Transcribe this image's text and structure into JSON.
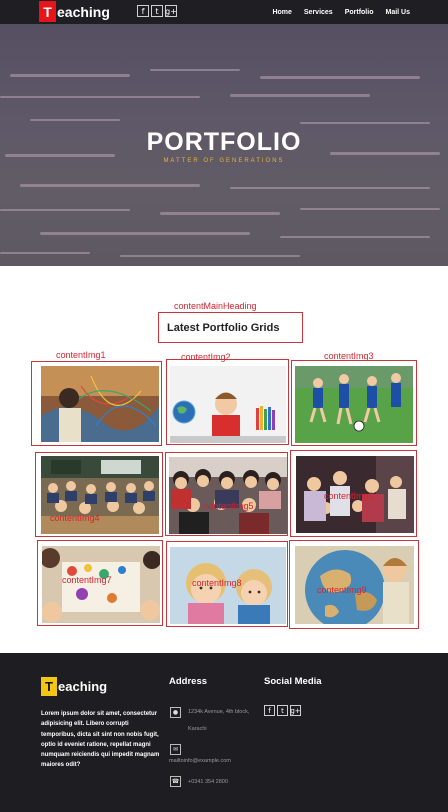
{
  "nav": {
    "logo_initial": "T",
    "logo_rest": "eaching",
    "social": [
      {
        "icon": "facebook-icon",
        "glyph": "f"
      },
      {
        "icon": "twitter-icon",
        "glyph": "t"
      },
      {
        "icon": "google-plus-icon",
        "glyph": "g+"
      }
    ],
    "menu": [
      "Home",
      "Services",
      "Portfolio",
      "Mail Us"
    ]
  },
  "hero": {
    "title": "PORTFOLIO",
    "subtitle": "MATTER OF GENERATIONS"
  },
  "content": {
    "main_heading_annotation": "contentMainHeading",
    "main_heading": "Latest Portfolio Grids",
    "images": [
      {
        "label": "contentImg1",
        "alt": "children crafting with colorful yarn"
      },
      {
        "label": "contentImg2",
        "alt": "boy at desk with globe and pencils"
      },
      {
        "label": "contentImg3",
        "alt": "kids playing soccer on field"
      },
      {
        "label": "contentImg4",
        "alt": "classroom full of students"
      },
      {
        "label": "contentImg5",
        "alt": "group of smiling kids"
      },
      {
        "label": "contentImg6",
        "alt": "mothers and children in classroom"
      },
      {
        "label": "contentImg7",
        "alt": "kids painting at table"
      },
      {
        "label": "contentImg8",
        "alt": "two smiling blond children"
      },
      {
        "label": "contentImg9",
        "alt": "child pointing at globe"
      }
    ]
  },
  "footer": {
    "logo_initial": "T",
    "logo_rest": "eaching",
    "description": "Lorem ipsum dolor sit amet, consectetur adipisicing elit. Libero corrupti temporibus, dicta sit sint non nobis fugit, optio id eveniet ratione, repellat magni numquam reiciendis qui impedit magnam maiores odit?",
    "address_heading": "Address",
    "address_line1": "1234k Avenue, 4th block,",
    "address_line2": "Karachi",
    "email": "mailtoinfo@example.com",
    "phone": "+0341 354 2800",
    "social_heading": "Social Media",
    "social": [
      {
        "icon": "facebook-icon",
        "glyph": "f"
      },
      {
        "icon": "twitter-icon",
        "glyph": "t"
      },
      {
        "icon": "google-plus-icon",
        "glyph": "g+"
      }
    ]
  },
  "colors": {
    "brand_red": "#e8141b",
    "brand_yellow": "#f2c615",
    "annotation_red": "#d42530",
    "footer_bg": "#1e1e22"
  }
}
